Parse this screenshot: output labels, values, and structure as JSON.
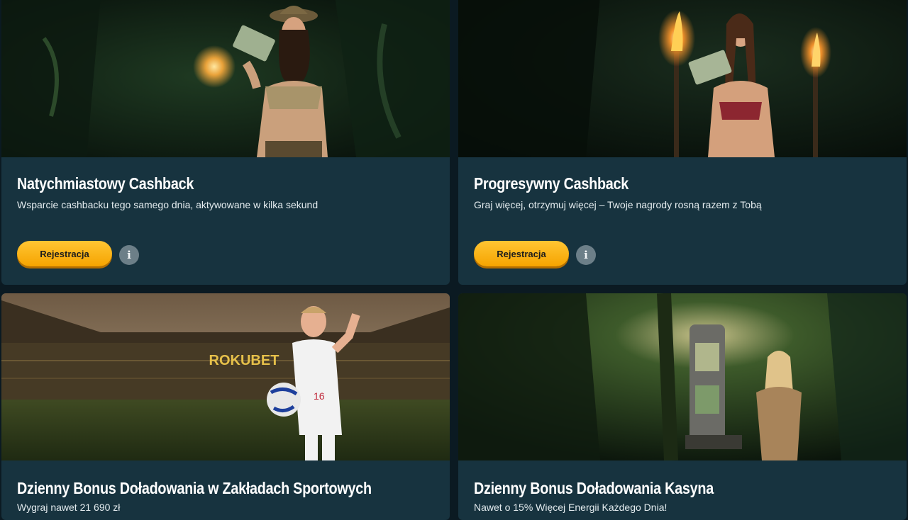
{
  "promotions": [
    {
      "title": "Natychmiastowy Cashback",
      "description": "Wsparcie cashbacku tego samego dnia, aktywowane w kilka sekund",
      "button_label": "Rejestracja",
      "info_icon": "i"
    },
    {
      "title": "Progresywny Cashback",
      "description": "Graj więcej, otrzymuj więcej – Twoje nagrody rosną razem z Tobą",
      "button_label": "Rejestracja",
      "info_icon": "i"
    },
    {
      "title": "Dzienny Bonus Doładowania w Zakładach Sportowych",
      "description": "Wygraj nawet 21 690 zł"
    },
    {
      "title": "Dzienny Bonus Doładowania Kasyna",
      "description": "Nawet o 15% Więcej Energii Każdego Dnia!"
    }
  ],
  "stadium_banner_text": "ROKUBET",
  "colors": {
    "card_background": "#17333f",
    "page_background": "#0b1a22",
    "button_accent": "#f6a400"
  }
}
